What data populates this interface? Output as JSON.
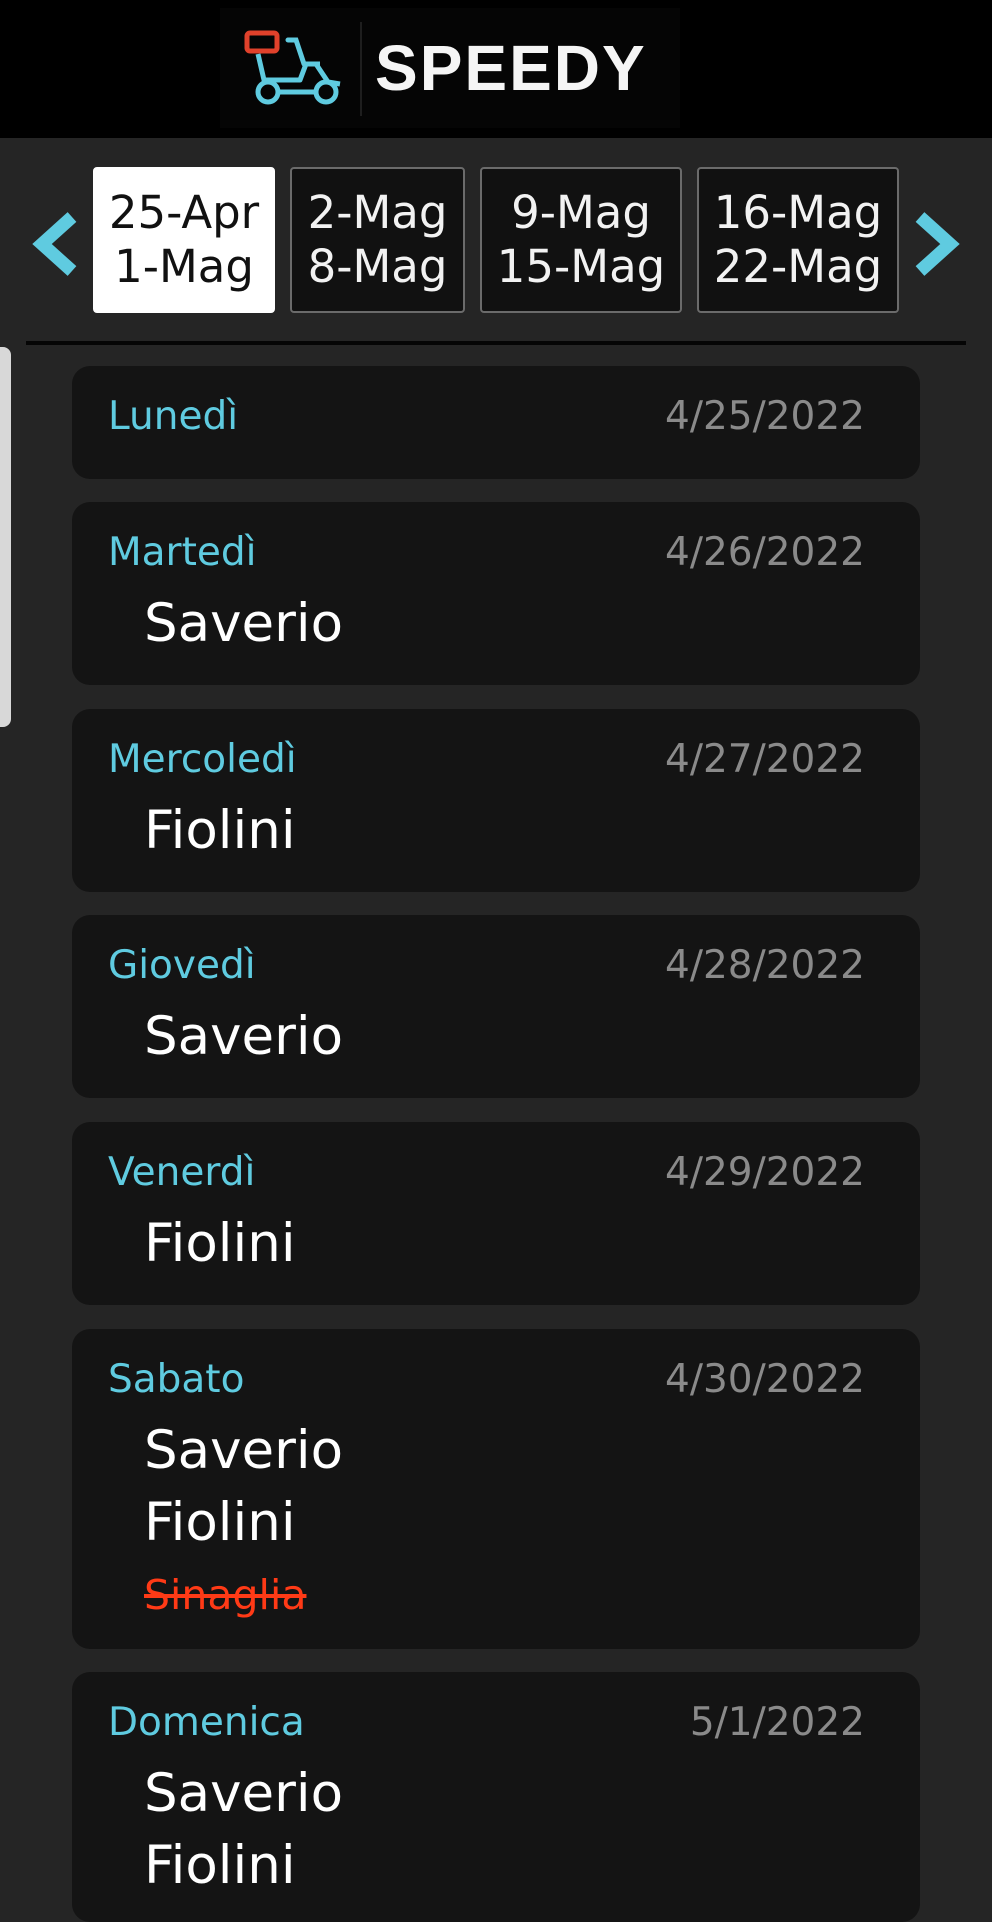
{
  "app": {
    "title": "SPEEDY",
    "logo_icon": "scooter-delivery-icon"
  },
  "colors": {
    "accent": "#5fcbe0",
    "cancelled": "#ff3a16",
    "logo_box": "#e0412b"
  },
  "nav": {
    "prev_icon": "chevron-left-icon",
    "next_icon": "chevron-right-icon"
  },
  "weeks": [
    {
      "start": "25-Apr",
      "end": "1-Mag",
      "selected": true
    },
    {
      "start": "2-Mag",
      "end": "8-Mag",
      "selected": false
    },
    {
      "start": "9-Mag",
      "end": "15-Mag",
      "selected": false
    },
    {
      "start": "16-Mag",
      "end": "22-Mag",
      "selected": false
    }
  ],
  "days": [
    {
      "name": "Lunedì",
      "date": "4/25/2022",
      "people": []
    },
    {
      "name": "Martedì",
      "date": "4/26/2022",
      "people": [
        {
          "name": "Saverio"
        }
      ]
    },
    {
      "name": "Mercoledì",
      "date": "4/27/2022",
      "people": [
        {
          "name": "Fiolini"
        }
      ]
    },
    {
      "name": "Giovedì",
      "date": "4/28/2022",
      "people": [
        {
          "name": "Saverio"
        }
      ]
    },
    {
      "name": "Venerdì",
      "date": "4/29/2022",
      "people": [
        {
          "name": "Fiolini"
        }
      ]
    },
    {
      "name": "Sabato",
      "date": "4/30/2022",
      "people": [
        {
          "name": "Saverio"
        },
        {
          "name": "Fiolini"
        },
        {
          "name": "Sinaglia",
          "cancelled": true
        }
      ]
    },
    {
      "name": "Domenica",
      "date": "5/1/2022",
      "people": [
        {
          "name": "Saverio"
        },
        {
          "name": "Fiolini"
        }
      ]
    }
  ]
}
